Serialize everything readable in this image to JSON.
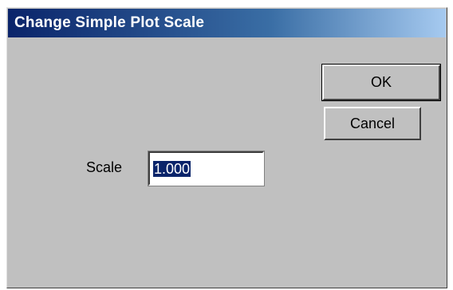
{
  "dialog": {
    "title": "Change Simple Plot Scale",
    "ok_label": "OK",
    "cancel_label": "Cancel",
    "scale_label": "Scale",
    "scale_value": "1.000"
  },
  "colors": {
    "titlebar_start": "#0a246a",
    "titlebar_end": "#a6caf0",
    "dialog_background": "#c0c0c0",
    "selection_highlight": "#0a246a"
  }
}
